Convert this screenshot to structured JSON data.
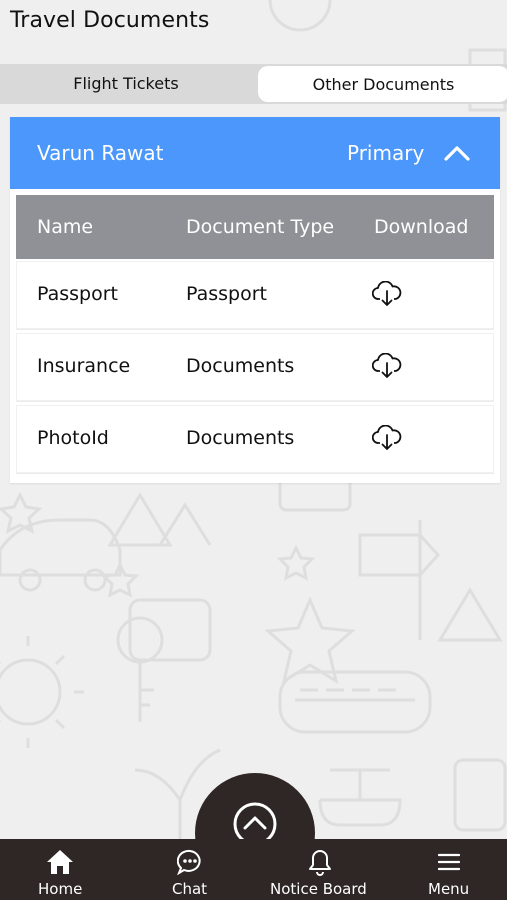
{
  "header": {
    "title": "Travel Documents"
  },
  "tabs": [
    {
      "label": "Flight Tickets",
      "active": false
    },
    {
      "label": "Other Documents",
      "active": true
    }
  ],
  "traveler": {
    "name": "Varun Rawat",
    "role": "Primary",
    "expanded": true
  },
  "table": {
    "columns": [
      "Name",
      "Document Type",
      "Download"
    ],
    "rows": [
      {
        "name": "Passport",
        "type": "Passport",
        "download_icon": "cloud-download-icon"
      },
      {
        "name": "Insurance",
        "type": "Documents",
        "download_icon": "cloud-download-icon"
      },
      {
        "name": "PhotoId",
        "type": "Documents",
        "download_icon": "cloud-download-icon"
      }
    ]
  },
  "fab": {
    "icon": "chevron-up-circle-icon"
  },
  "bottom_nav": [
    {
      "label": "Home",
      "icon": "home-icon"
    },
    {
      "label": "Chat",
      "icon": "chat-icon"
    },
    {
      "label": "Notice Board",
      "icon": "bell-icon"
    },
    {
      "label": "Menu",
      "icon": "hamburger-menu-icon"
    }
  ],
  "colors": {
    "accent": "#4c97fb",
    "table_header": "#8f9196",
    "bottom_bar": "#2e2726",
    "background": "#efefef"
  }
}
